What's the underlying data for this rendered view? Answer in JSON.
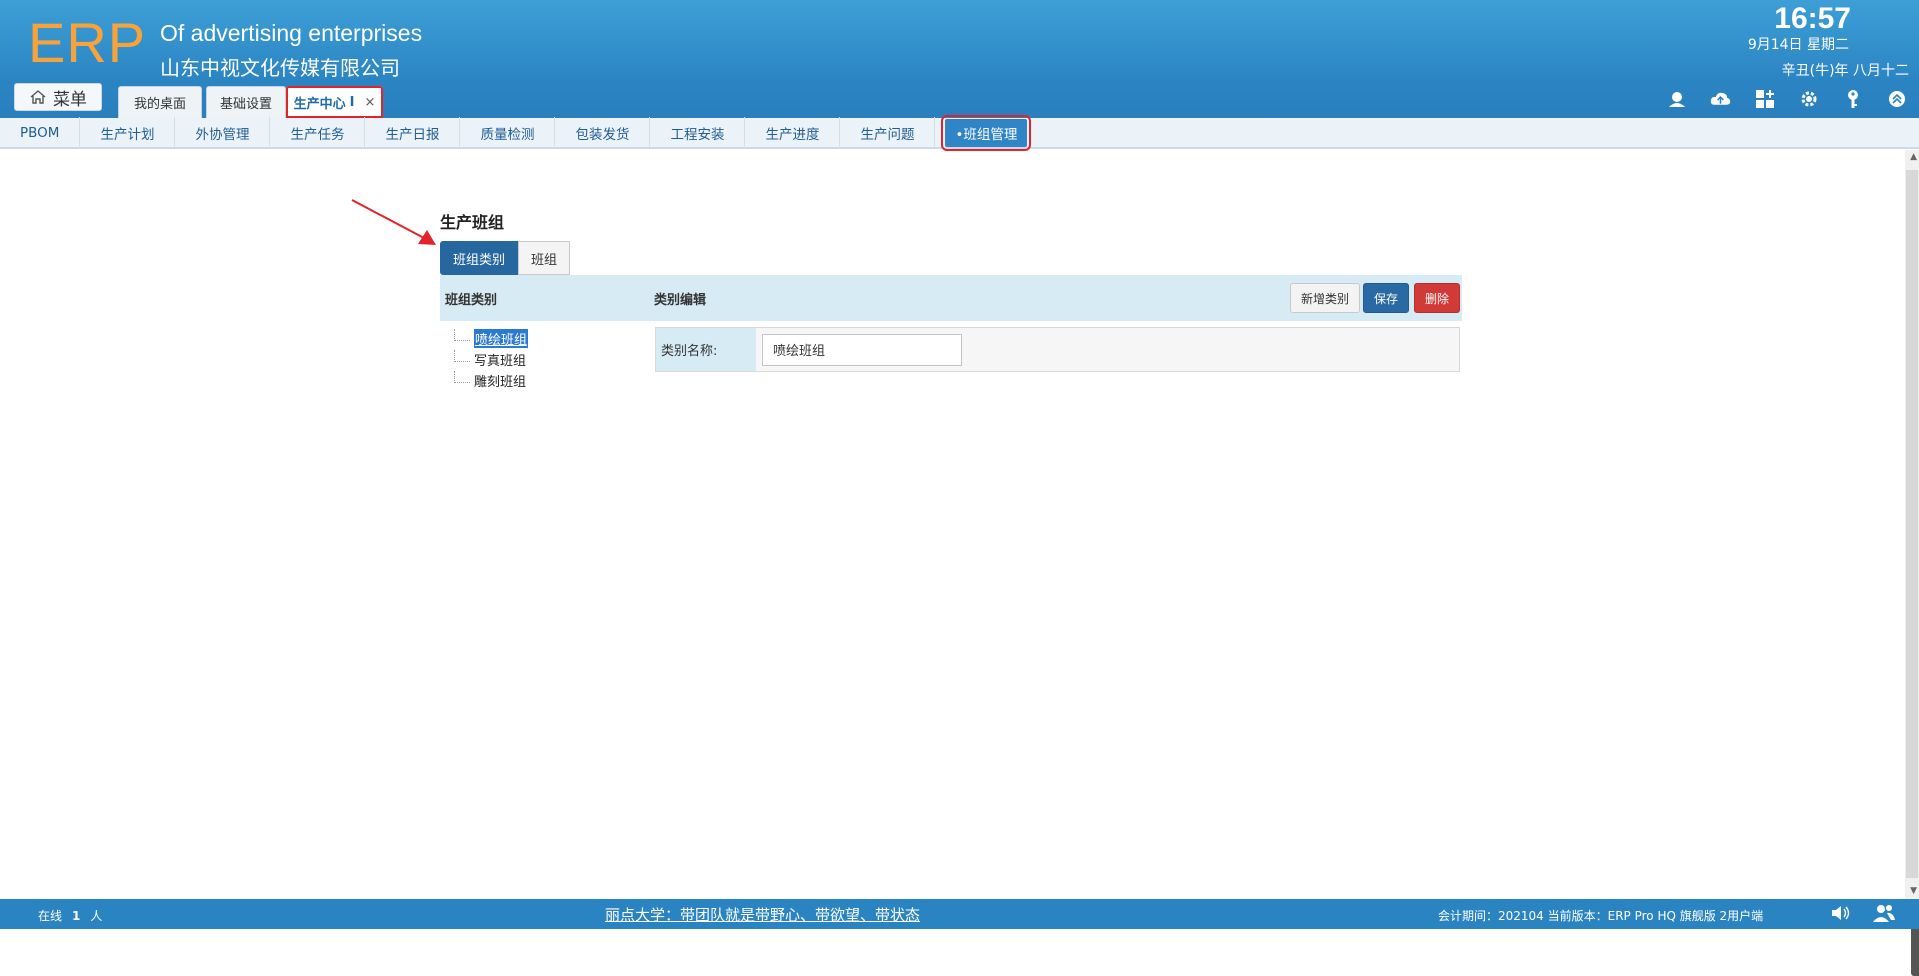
{
  "header": {
    "logo": "ERP",
    "company_en": "Of advertising enterprises",
    "company_cn": "山东中视文化传媒有限公司",
    "time": "16:57",
    "date": "9月14日 星期二",
    "lunar_date": "辛丑(牛)年 八月十二",
    "menu_label": "菜单",
    "tabs": [
      {
        "label": "我的桌面"
      },
      {
        "label": "基础设置"
      },
      {
        "label": "生产中心",
        "marker": "I",
        "close": "×"
      }
    ],
    "icons": [
      "user-icon",
      "cloud-icon",
      "apps-icon",
      "gear-icon",
      "key-icon",
      "collapse-icon"
    ]
  },
  "subnav": {
    "items": [
      "PBOM",
      "生产计划",
      "外协管理",
      "生产任务",
      "生产日报",
      "质量检测",
      "包装发货",
      "工程安装",
      "生产进度",
      "生产问题"
    ],
    "active": "•班组管理"
  },
  "panel": {
    "title": "生产班组",
    "tabs": [
      "班组类别",
      "班组"
    ],
    "left_header": "班组类别",
    "right_header": "类别编辑",
    "buttons": {
      "add": "新增类别",
      "save": "保存",
      "delete": "删除"
    },
    "tree": [
      "喷绘班组",
      "写真班组",
      "雕刻班组"
    ],
    "form": {
      "label": "类别名称:",
      "value": "喷绘班组"
    }
  },
  "footer": {
    "online_label": "在线",
    "online_count": "1",
    "online_unit": "人",
    "motto": "丽点大学：带团队就是带野心、带欲望、带状态",
    "version": "会计期间：202104 当前版本：ERP Pro HQ 旗舰版 2用户端"
  },
  "colors": {
    "header_blue": "#2b84c2",
    "logo_orange": "#f7a23a",
    "highlight_red": "#e2232b",
    "tab_active_blue": "#27679f",
    "delete_red": "#d03a37"
  }
}
